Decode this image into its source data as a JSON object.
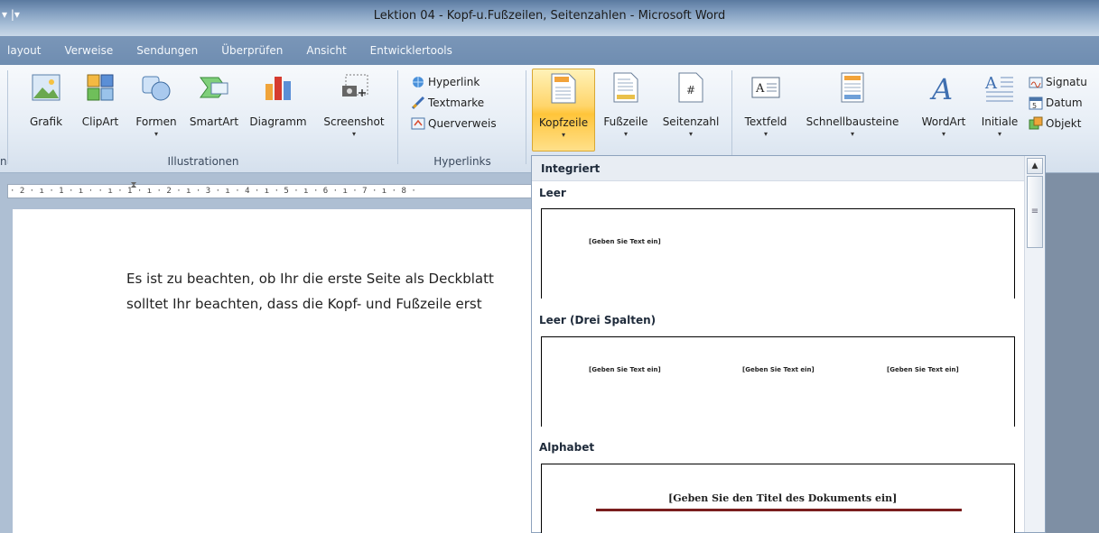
{
  "window": {
    "qat": "▾ |▾",
    "title": "Lektion 04 - Kopf-u.Fußzeilen, Seitenzahlen - Microsoft Word"
  },
  "tabs": [
    "layout",
    "Verweise",
    "Sendungen",
    "Überprüfen",
    "Ansicht",
    "Entwicklertools"
  ],
  "ribbon": {
    "illustrations": {
      "label": "Illustrationen",
      "buttons": [
        "Grafik",
        "ClipArt",
        "Formen",
        "SmartArt",
        "Diagramm",
        "Screenshot"
      ]
    },
    "hyperlinks": {
      "label": "Hyperlinks",
      "buttons": [
        "Hyperlink",
        "Textmarke",
        "Querverweis"
      ]
    },
    "header_footer": {
      "buttons": [
        "Kopfzeile",
        "Fußzeile",
        "Seitenzahl"
      ]
    },
    "text": {
      "buttons": [
        "Textfeld",
        "Schnellbausteine",
        "WordArt",
        "Initiale"
      ],
      "small": [
        "Signatu",
        "Datum",
        "Objekt"
      ]
    },
    "left_stub": "n"
  },
  "ruler": {
    "text": "· 2 · ı · 1 · ı ·   · ı · 1 · ı · 2 · ı · 3 · ı · 4 · ı · 5 · ı · 6 · ı · 7 · ı · 8 ·"
  },
  "document": {
    "lines": [
      "Es ist zu beachten, ob Ihr die erste Seite als Deckblatt",
      "solltet Ihr beachten, dass die Kopf- und Fußzeile erst"
    ]
  },
  "gallery": {
    "header": "Integriert",
    "items": [
      {
        "label": "Leer",
        "placeholders": [
          "[Geben Sie Text ein]"
        ]
      },
      {
        "label": "Leer (Drei Spalten)",
        "placeholders": [
          "[Geben Sie Text ein]",
          "[Geben Sie Text ein]",
          "[Geben Sie Text ein]"
        ]
      },
      {
        "label": "Alphabet",
        "placeholders": [
          "[Geben Sie den Titel des Dokuments ein]"
        ]
      }
    ]
  },
  "colors": {
    "active_button": "#ffc53a",
    "alphabet_line": "#7a1e1e"
  }
}
